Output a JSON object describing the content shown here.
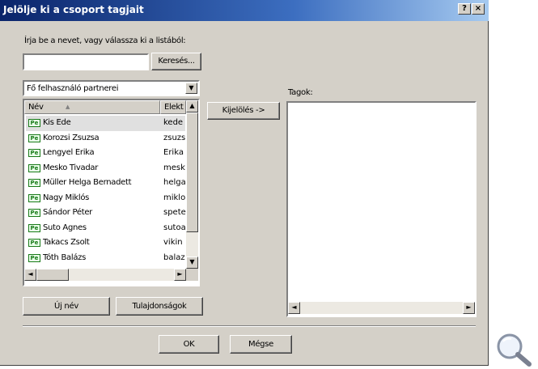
{
  "dialog": {
    "title": "Jelölje ki a csoport tagjait",
    "help_label": "?",
    "close_label": "×"
  },
  "search": {
    "prompt": "Írja be a nevet, vagy válassza ki a listából:",
    "value": "",
    "button_label": "Keresés..."
  },
  "address_book": {
    "selected": "Fő felhasználó partnerei"
  },
  "list": {
    "columns": [
      "Név",
      "Elekt"
    ],
    "rows": [
      {
        "name": "Kis Ede",
        "alias": "kede",
        "selected": true
      },
      {
        "name": "Korozsi Zsuzsa",
        "alias": "zsuzs"
      },
      {
        "name": "Lengyel Erika",
        "alias": "Erika"
      },
      {
        "name": "Mesko Tivadar",
        "alias": "mesk"
      },
      {
        "name": "Müller Helga Bernadett",
        "alias": "helga"
      },
      {
        "name": "Nagy Miklós",
        "alias": "miklo"
      },
      {
        "name": "Sándor Péter",
        "alias": "spete"
      },
      {
        "name": "Suto Agnes",
        "alias": "sutoa"
      },
      {
        "name": "Takacs Zsolt",
        "alias": "vikin"
      },
      {
        "name": "Tóth Balázs",
        "alias": "balaz"
      }
    ],
    "row_icon_text": "Pe"
  },
  "select_button_label": "Kijelölés ->",
  "members": {
    "label": "Tagok:"
  },
  "buttons": {
    "new_name": "Új név",
    "properties": "Tulajdonságok",
    "ok": "OK",
    "cancel": "Mégse"
  },
  "icons": {
    "scroll_up": "▲",
    "scroll_down": "▼",
    "scroll_left": "◄",
    "scroll_right": "►",
    "combo_arrow": "▼",
    "sort": "▲"
  },
  "colors": {
    "titlebar_start": "#0a246a",
    "titlebar_end": "#a6caf0",
    "dialog_bg": "#d4d0c8"
  }
}
